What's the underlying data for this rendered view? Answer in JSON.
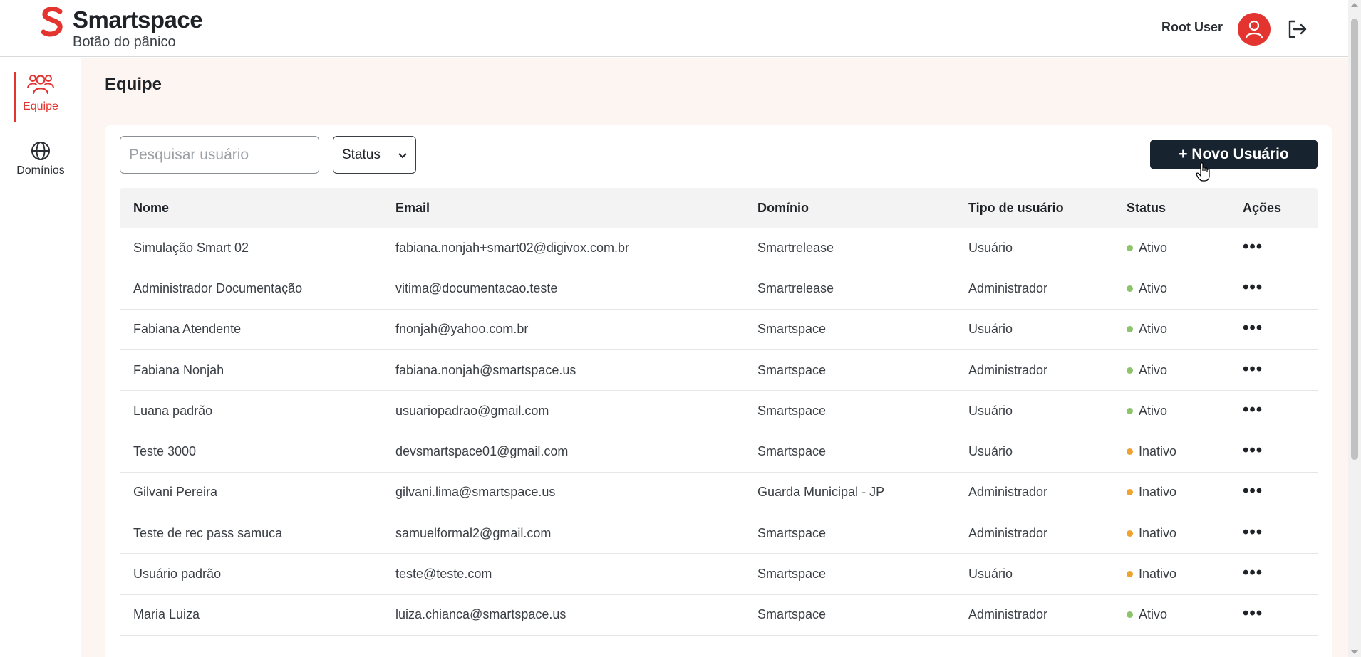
{
  "header": {
    "brand_name": "Smartspace",
    "brand_subtitle": "Botão do pânico",
    "user_name": "Root User"
  },
  "sidebar": {
    "items": [
      {
        "label": "Equipe",
        "icon": "team-icon",
        "active": true
      },
      {
        "label": "Domínios",
        "icon": "globe-icon",
        "active": false
      }
    ]
  },
  "main": {
    "page_title": "Equipe",
    "search": {
      "placeholder": "Pesquisar usuário",
      "value": ""
    },
    "status_filter": {
      "selected": "Status"
    },
    "new_user_button": "+ Novo Usuário"
  },
  "table": {
    "columns": [
      "Nome",
      "Email",
      "Domínio",
      "Tipo de usuário",
      "Status",
      "Ações"
    ],
    "rows": [
      {
        "nome": "Simulação Smart 02",
        "email": "fabiana.nonjah+smart02@digivox.com.br",
        "dominio": "Smartrelease",
        "tipo": "Usuário",
        "status": "Ativo",
        "acoes": "•••"
      },
      {
        "nome": "Administrador Documentação",
        "email": "vitima@documentacao.teste",
        "dominio": "Smartrelease",
        "tipo": "Administrador",
        "status": "Ativo",
        "acoes": "•••"
      },
      {
        "nome": "Fabiana Atendente",
        "email": "fnonjah@yahoo.com.br",
        "dominio": "Smartspace",
        "tipo": "Usuário",
        "status": "Ativo",
        "acoes": "•••"
      },
      {
        "nome": "Fabiana Nonjah",
        "email": "fabiana.nonjah@smartspace.us",
        "dominio": "Smartspace",
        "tipo": "Administrador",
        "status": "Ativo",
        "acoes": "•••"
      },
      {
        "nome": "Luana padrão",
        "email": "usuariopadrao@gmail.com",
        "dominio": "Smartspace",
        "tipo": "Usuário",
        "status": "Ativo",
        "acoes": "•••"
      },
      {
        "nome": "Teste 3000",
        "email": "devsmartspace01@gmail.com",
        "dominio": "Smartspace",
        "tipo": "Usuário",
        "status": "Inativo",
        "acoes": "•••"
      },
      {
        "nome": "Gilvani Pereira",
        "email": "gilvani.lima@smartspace.us",
        "dominio": "Guarda Municipal - JP",
        "tipo": "Administrador",
        "status": "Inativo",
        "acoes": "•••"
      },
      {
        "nome": "Teste de rec pass samuca",
        "email": "samuelformal2@gmail.com",
        "dominio": "Smartspace",
        "tipo": "Administrador",
        "status": "Inativo",
        "acoes": "•••"
      },
      {
        "nome": "Usuário padrão",
        "email": "teste@teste.com",
        "dominio": "Smartspace",
        "tipo": "Usuário",
        "status": "Inativo",
        "acoes": "•••"
      },
      {
        "nome": "Maria Luiza",
        "email": "luiza.chianca@smartspace.us",
        "dominio": "Smartspace",
        "tipo": "Administrador",
        "status": "Ativo",
        "acoes": "•••"
      }
    ]
  },
  "colors": {
    "accent": "#e3342f",
    "button_dark": "#17232e",
    "status_active": "#8cc46a",
    "status_inactive": "#f0a22e",
    "main_background": "#fdf5f1"
  }
}
